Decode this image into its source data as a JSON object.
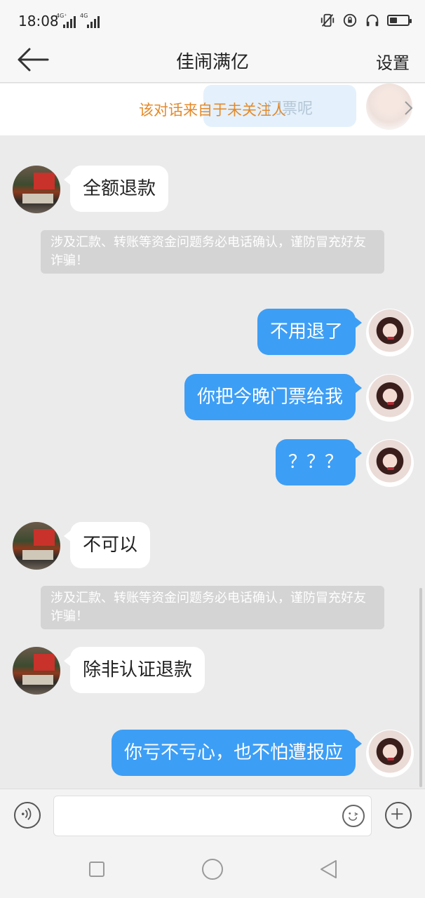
{
  "status_bar": {
    "time": "18:08",
    "signal1_label": "4G⁺",
    "signal2_label": "4G"
  },
  "header": {
    "title": "佳闹满亿",
    "settings_label": "设置"
  },
  "notice": {
    "text": "该对话来自于未关注人",
    "ghost_text": "门票呢"
  },
  "messages": [
    {
      "side": "in",
      "text": "全额退款"
    },
    {
      "side": "system",
      "text": "涉及汇款、转账等资金问题务必电话确认，谨防冒充好友诈骗！"
    },
    {
      "side": "out",
      "text": "不用退了"
    },
    {
      "side": "out",
      "text": "你把今晚门票给我"
    },
    {
      "side": "out",
      "text": "？？？"
    },
    {
      "side": "in",
      "text": "不可以"
    },
    {
      "side": "system",
      "text": "涉及汇款、转账等资金问题务必电话确认，谨防冒充好友诈骗！"
    },
    {
      "side": "in",
      "text": "除非认证退款"
    },
    {
      "side": "out",
      "text": "你亏不亏心，也不怕遭报应"
    }
  ],
  "input": {
    "value": "",
    "placeholder": ""
  },
  "colors": {
    "outgoing_bubble": "#3d9ef5",
    "incoming_bubble": "#ffffff",
    "notice_text": "#e48a2a",
    "background": "#ebebeb"
  }
}
